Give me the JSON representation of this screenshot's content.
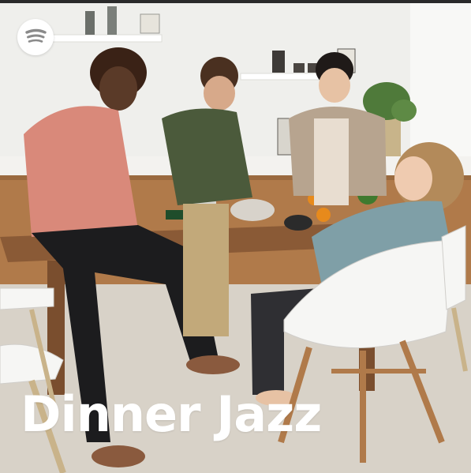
{
  "cover": {
    "title": "Dinner Jazz",
    "brand_icon": "spotify-logo-icon",
    "scene_description_icon": "kitchen-photo-image",
    "colors": {
      "title_text": "#ffffff",
      "wall": "#efefec",
      "floor": "#d8d2c8",
      "table_wood": "#8a5a36",
      "cabinet_wood": "#b07a4a"
    }
  }
}
